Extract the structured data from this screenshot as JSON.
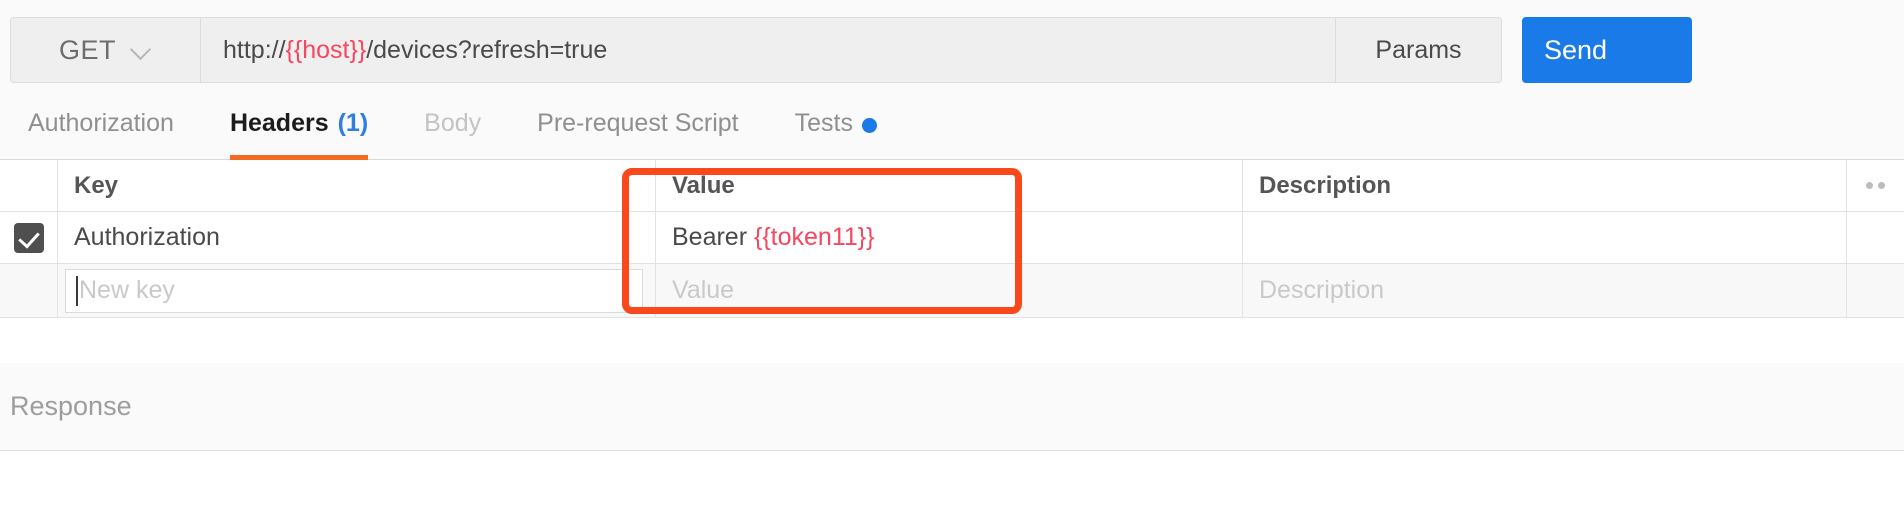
{
  "request_bar": {
    "method": "GET",
    "method_dropdown_icon": "chevron-down-icon",
    "url_prefix": "http://",
    "url_variable": "{{host}}",
    "url_suffix": "/devices?refresh=true",
    "params_label": "Params",
    "send_label": "Send"
  },
  "tabs": [
    {
      "label": "Authorization",
      "state": "inactive",
      "count": "",
      "dot": false
    },
    {
      "label": "Headers",
      "state": "active",
      "count": "(1)",
      "dot": false
    },
    {
      "label": "Body",
      "state": "disabled",
      "count": "",
      "dot": false
    },
    {
      "label": "Pre-request Script",
      "state": "inactive",
      "count": "",
      "dot": false
    },
    {
      "label": "Tests",
      "state": "inactive",
      "count": "",
      "dot": true
    }
  ],
  "headers_table": {
    "columns": {
      "key": "Key",
      "value": "Value",
      "description": "Description",
      "more_icon": "ellipsis-icon"
    },
    "rows": [
      {
        "checked": true,
        "key": "Authorization",
        "value_text": "Bearer ",
        "value_variable": "{{token11}}",
        "description": ""
      }
    ],
    "new_row": {
      "key_placeholder": "New key",
      "value_placeholder": "Value",
      "description_placeholder": "Description"
    }
  },
  "response": {
    "label": "Response"
  },
  "annotation": {
    "shape": "rounded-rectangle-highlight",
    "color": "#f8481c"
  },
  "colors": {
    "accent_orange": "#f26b21",
    "annotation_orange": "#f8481c",
    "brand_blue": "#1a7ae8",
    "variable_red": "#f5475f",
    "panel_bg": "#fafafa"
  }
}
